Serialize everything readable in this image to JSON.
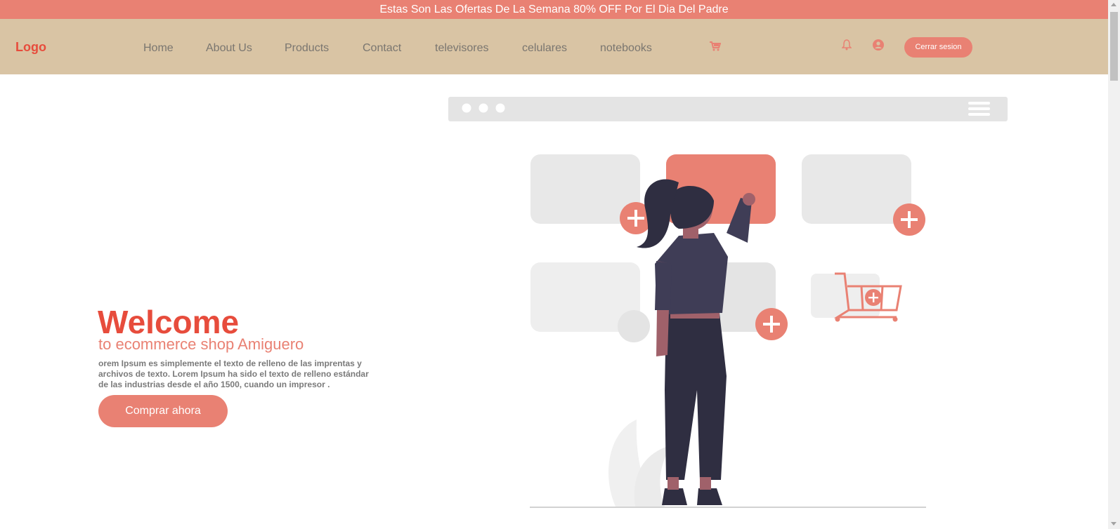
{
  "promo": {
    "text": "Estas Son Las Ofertas De La Semana 80% OFF Por El Dia Del Padre"
  },
  "header": {
    "logo": "Logo",
    "nav": [
      {
        "label": "Home"
      },
      {
        "label": "About Us"
      },
      {
        "label": "Products"
      },
      {
        "label": "Contact"
      },
      {
        "label": "televisores"
      },
      {
        "label": "celulares"
      },
      {
        "label": "notebooks"
      }
    ],
    "icons": {
      "cart": "cart-icon",
      "bell": "bell-icon",
      "user": "user-circle-icon"
    },
    "logout_label": "Cerrar sesion"
  },
  "hero": {
    "title": "Welcome",
    "subtitle": "to ecommerce shop Amiguero",
    "text": "orem Ipsum es simplemente el texto de relleno de las imprentas y archivos de texto. Lorem Ipsum ha sido el texto de relleno estándar de las industrias desde el año 1500, cuando un impresor .",
    "button_label": "Comprar ahora"
  },
  "colors": {
    "accent": "#e98173",
    "brand": "#e74c3c",
    "header_bg": "#d9c4a4",
    "figure_dark": "#2f2e41"
  }
}
